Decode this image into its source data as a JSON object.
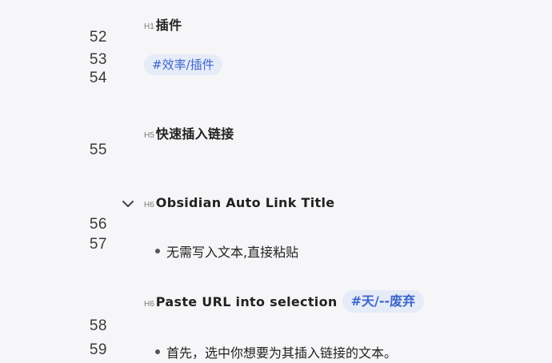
{
  "editor": {
    "line_numbers": {
      "l52": "52",
      "l53": "53",
      "l54": "54",
      "l55": "55",
      "l56": "56",
      "l57": "57",
      "l58": "58",
      "l59": "59"
    },
    "heading_plugins": {
      "level": "H1",
      "text": "插件"
    },
    "tag_efficiency": "#效率/插件",
    "heading_quick_insert": {
      "level": "H5",
      "text": "快速插入链接"
    },
    "heading_auto_link": {
      "level": "H6",
      "text": "Obsidian Auto Link Title"
    },
    "bullet_no_text": "无需写入文本,直接粘贴",
    "heading_paste_url": {
      "level": "H6",
      "text": "Paste URL into selection"
    },
    "tag_deprecated": "#天/--废弃",
    "bullet_select_text": "首先，选中你想要为其插入链接的文本。",
    "icons": {
      "fold": "chevron-down-icon",
      "bullet": "bullet-dot"
    }
  }
}
